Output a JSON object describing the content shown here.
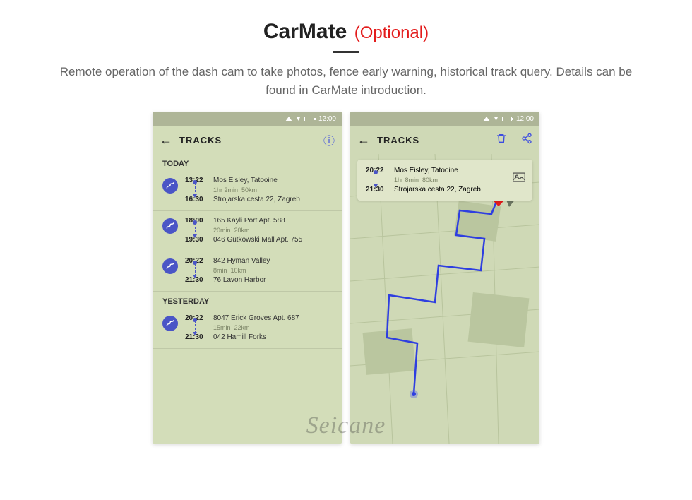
{
  "header": {
    "title": "CarMate",
    "optional": "(Optional)",
    "description": "Remote operation of the dash cam to take photos, fence early warning, historical track query. Details can be found in CarMate introduction."
  },
  "statusbar": {
    "time": "12:00"
  },
  "left": {
    "appbar_title": "TRACKS",
    "info_icon": "info-icon",
    "sections": [
      {
        "label": "TODAY",
        "tracks": [
          {
            "start_time": "13:22",
            "start_place": "Mos Eisley, Tatooine",
            "duration": "1hr 2min",
            "distance": "50km",
            "end_time": "16:30",
            "end_place": "Strojarska cesta 22, Zagreb"
          },
          {
            "start_time": "18:00",
            "start_place": "165 Kayli Port Apt. 588",
            "duration": "20min",
            "distance": "20km",
            "end_time": "19:30",
            "end_place": "046 Gutkowski Mall Apt. 755"
          },
          {
            "start_time": "20:22",
            "start_place": "842 Hyman Valley",
            "duration": "8min",
            "distance": "10km",
            "end_time": "21:30",
            "end_place": "76 Lavon Harbor"
          }
        ]
      },
      {
        "label": "YESTERDAY",
        "tracks": [
          {
            "start_time": "20:22",
            "start_place": "8047 Erick Groves Apt. 687",
            "duration": "15min",
            "distance": "22km",
            "end_time": "21:30",
            "end_place": "042 Hamill Forks"
          }
        ]
      }
    ]
  },
  "right": {
    "appbar_title": "TRACKS",
    "card": {
      "start_time": "20:22",
      "start_place": "Mos Eisley, Tatooine",
      "duration": "1hr 8min",
      "distance": "80km",
      "end_time": "21:30",
      "end_place": "Strojarska cesta 22, Zagreb"
    }
  },
  "watermark": "Seicane"
}
